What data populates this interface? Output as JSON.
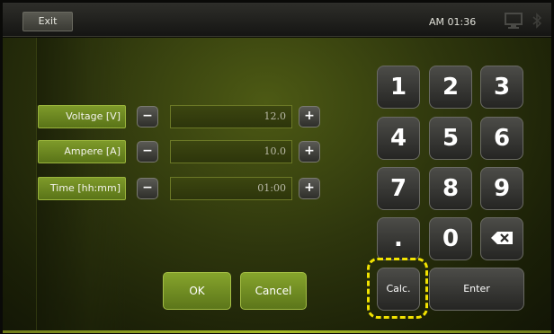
{
  "topbar": {
    "exit_label": "Exit",
    "clock": "AM 01:36",
    "icons": [
      "monitor-icon",
      "bluetooth-icon"
    ]
  },
  "params": [
    {
      "label": "Voltage [V]",
      "value": "12.0"
    },
    {
      "label": "Ampere [A]",
      "value": "10.0"
    },
    {
      "label": "Time [hh:mm]",
      "value": "01:00"
    }
  ],
  "steppers": {
    "minus": "−",
    "plus": "+"
  },
  "actions": {
    "ok": "OK",
    "cancel": "Cancel"
  },
  "keypad": {
    "digits": [
      "1",
      "2",
      "3",
      "4",
      "5",
      "6",
      "7",
      "8",
      "9",
      ".",
      "0"
    ],
    "backspace_icon": "backspace-icon",
    "calc": "Calc.",
    "enter": "Enter"
  },
  "colors": {
    "accent_green": "#6f8a22",
    "highlight": "#f2e300"
  }
}
